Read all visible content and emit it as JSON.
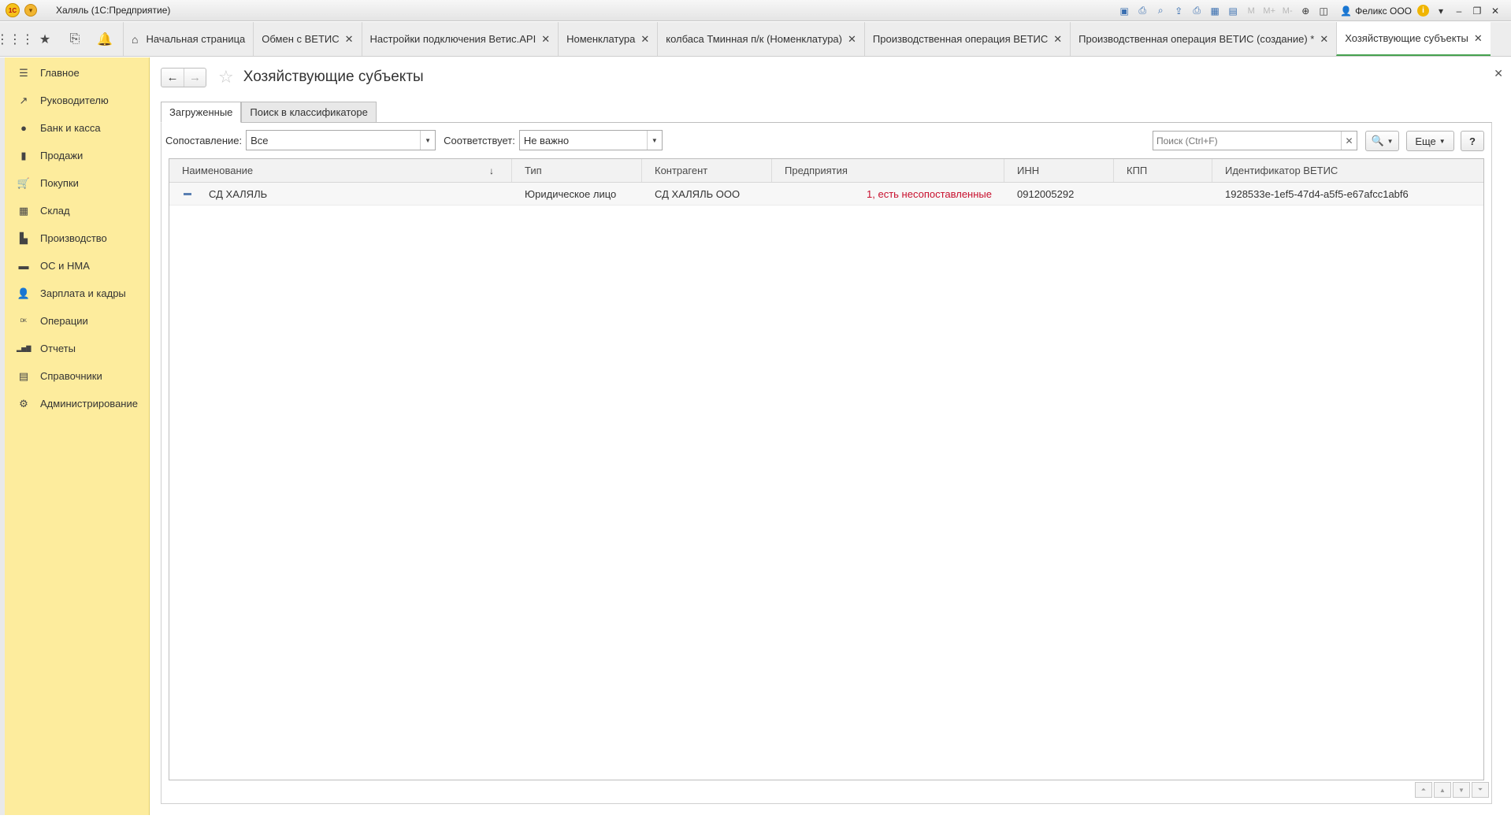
{
  "window": {
    "logo": "1С",
    "title": "Халяль  (1С:Предприятие)",
    "user": "Феликс ООО",
    "toolbar_icons": [
      "save-icon",
      "print-icon",
      "preview-icon",
      "export-icon",
      "print2-icon",
      "calc-icon",
      "calendar-icon"
    ],
    "memory_labels": [
      "M",
      "M+",
      "M-"
    ]
  },
  "tabs": [
    {
      "label": "Начальная страница",
      "home": true,
      "closable": false
    },
    {
      "label": "Обмен с ВЕТИС",
      "closable": true
    },
    {
      "label": "Настройки подключения Ветис.API",
      "closable": true
    },
    {
      "label": "Номенклатура",
      "closable": true
    },
    {
      "label": "колбаса Тминная п/к (Номенклатура)",
      "closable": true
    },
    {
      "label": "Производственная операция ВЕТИС",
      "closable": true
    },
    {
      "label": "Производственная операция ВЕТИС (создание) *",
      "closable": true
    },
    {
      "label": "Хозяйствующие субъекты",
      "closable": true,
      "active": true
    }
  ],
  "sidebar": {
    "items": [
      {
        "label": "Главное",
        "icon": "menu-icon"
      },
      {
        "label": "Руководителю",
        "icon": "trend-icon"
      },
      {
        "label": "Банк и касса",
        "icon": "coin-icon"
      },
      {
        "label": "Продажи",
        "icon": "bag-icon"
      },
      {
        "label": "Покупки",
        "icon": "cart-icon"
      },
      {
        "label": "Склад",
        "icon": "warehouse-icon"
      },
      {
        "label": "Производство",
        "icon": "factory-icon"
      },
      {
        "label": "ОС и НМА",
        "icon": "truck-icon"
      },
      {
        "label": "Зарплата и кадры",
        "icon": "person-icon"
      },
      {
        "label": "Операции",
        "icon": "dtkt-icon"
      },
      {
        "label": "Отчеты",
        "icon": "barchart-icon"
      },
      {
        "label": "Справочники",
        "icon": "books-icon"
      },
      {
        "label": "Администрирование",
        "icon": "gear-icon"
      }
    ]
  },
  "form": {
    "title": "Хозяйствующие субъекты",
    "tabs": [
      "Загруженные",
      "Поиск в классификаторе"
    ],
    "filters": {
      "match_label": "Сопоставление:",
      "match_value": "Все",
      "corresponds_label": "Соответствует:",
      "corresponds_value": "Не важно"
    },
    "search_placeholder": "Поиск (Ctrl+F)",
    "more_label": "Еще",
    "help_label": "?"
  },
  "table": {
    "columns": [
      "Наименование",
      "Тип",
      "Контрагент",
      "Предприятия",
      "ИНН",
      "КПП",
      "Идентификатор ВЕТИС"
    ],
    "sort_indicator": "↓",
    "rows": [
      {
        "name": "СД ХАЛЯЛЬ",
        "type": "Юридическое лицо",
        "counterparty": "СД ХАЛЯЛЬ ООО",
        "enterprises": "1, есть несопоставленные",
        "inn": "0912005292",
        "kpp": "",
        "vetis_id": "1928533e-1ef5-47d4-a5f5-e67afcc1abf6"
      }
    ]
  },
  "colors": {
    "sidebar_bg": "#fdec9d",
    "active_tab_accent": "#45a14e",
    "warning_text": "#c8102e"
  }
}
